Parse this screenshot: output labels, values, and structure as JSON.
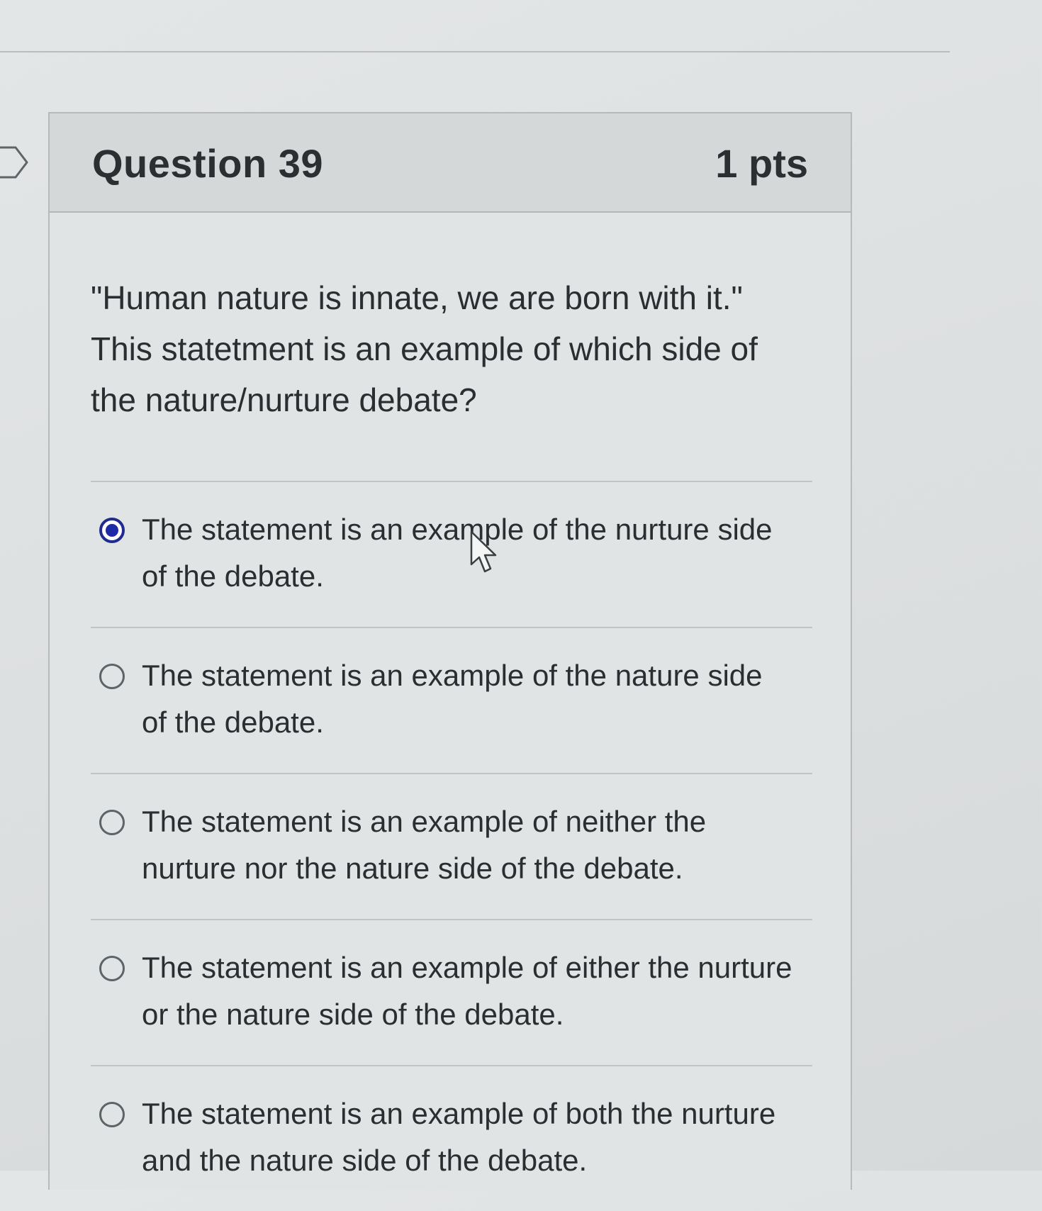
{
  "question": {
    "title": "Question 39",
    "points": "1 pts",
    "text_lines": [
      "\"Human nature is innate, we are born with it.\"",
      "This statetment is an example of which side of",
      "the nature/nurture debate?"
    ]
  },
  "answers": [
    {
      "label": "The statement is an example of the nurture side of the debate.",
      "selected": true
    },
    {
      "label": "The statement is an example of the nature side of the debate.",
      "selected": false
    },
    {
      "label": "The statement is an example of neither the nurture nor the nature side of the debate.",
      "selected": false
    },
    {
      "label": "The statement is an example of either the nurture or the nature side of the debate.",
      "selected": false
    },
    {
      "label": "The statement is an example of both the nurture and the nature side of the debate.",
      "selected": false
    }
  ],
  "colors": {
    "radio_selected": "#1e2aa6",
    "text": "#2a2e31",
    "header_bg": "#d5d8d9"
  },
  "icons": {
    "flag": "flag-icon",
    "cursor": "mouse-pointer-icon"
  }
}
